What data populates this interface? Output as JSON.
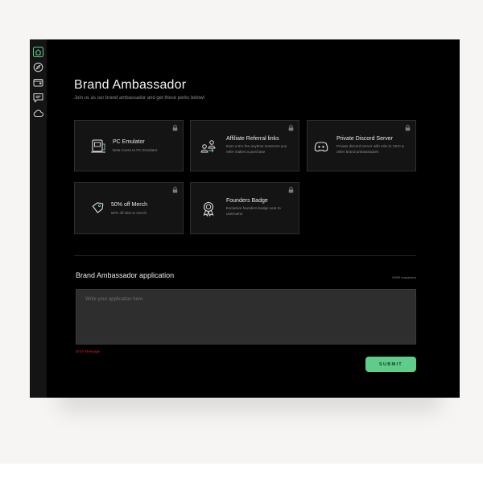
{
  "colors": {
    "accent": "#5fcc8a",
    "background": "#000000",
    "card": "#141414",
    "error": "#e02020"
  },
  "sidebar": {
    "items": [
      {
        "icon": "home-icon",
        "active": true
      },
      {
        "icon": "compass-icon"
      },
      {
        "icon": "wallet-icon"
      },
      {
        "icon": "chat-icon"
      },
      {
        "icon": "cloud-icon"
      }
    ]
  },
  "header": {
    "title": "Brand Ambassador",
    "subtitle": "Join us as our brand ambassador and get these perks below!"
  },
  "perks": [
    {
      "icon": "emulator-icon",
      "title": "PC Emulator",
      "description": "Beta Acess to PC Emulator",
      "locked": true
    },
    {
      "icon": "referral-icon",
      "title": "Affiliate Referral links",
      "description": "Earn a 5% fee anytime someone you refer makes a purchase",
      "locked": true
    },
    {
      "icon": "discord-icon",
      "title": "Private Discord Server",
      "description": "Private discord server with stim.io CEO & other brand ambassadors",
      "locked": true
    },
    {
      "icon": "tag-icon",
      "title": "50% off Merch",
      "description": "50% off stim.io merch",
      "locked": true
    },
    {
      "icon": "badge-icon",
      "title": "Founders Badge",
      "description": "Exclusive founders badge next to username",
      "locked": true
    }
  ],
  "application": {
    "title": "Brand Ambassador application",
    "char_count": "0/500 characters",
    "placeholder": "Write your application here",
    "value": "",
    "error": "Error Message",
    "submit_label": "SUBMIT"
  }
}
